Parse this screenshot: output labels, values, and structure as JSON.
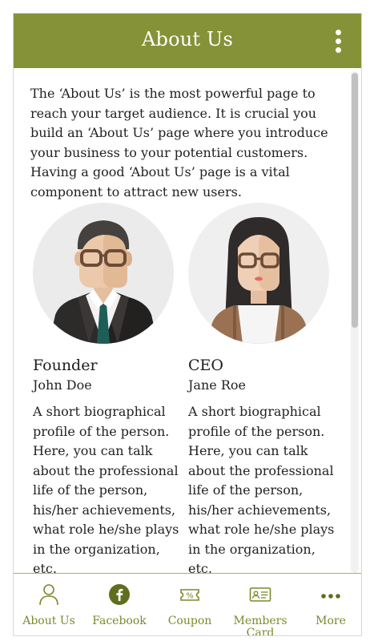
{
  "header": {
    "title": "About Us"
  },
  "intro": "The ‘About Us’ is the most powerful page to reach your target audience. It is crucial you build an ‘About Us’ page where you introduce your business to your potential customers. Having a good ‘About Us’ page is a vital component to attract new users.",
  "team": [
    {
      "role": "Founder",
      "name": "John Doe",
      "bio": "A short biographical profile of the person. Here, you can talk about the professional life of the person, his/her achievements, what role he/she plays in the organization, etc."
    },
    {
      "role": "CEO",
      "name": "Jane Roe",
      "bio": "A short biographical profile of the person. Here, you can talk about the professional life of the person, his/her achievements, what role he/she plays in the organization, etc."
    }
  ],
  "bottom_nav": {
    "items": [
      {
        "label": "About Us",
        "icon": "person-icon"
      },
      {
        "label": "Facebook",
        "icon": "facebook-icon"
      },
      {
        "label": "Coupon",
        "icon": "coupon-icon"
      },
      {
        "label": "Members Card",
        "icon": "members-card-icon"
      },
      {
        "label": "More",
        "icon": "more-dots-icon"
      }
    ]
  },
  "colors": {
    "header_bg": "#869237",
    "accent": "#7a8a2b",
    "facebook_bg": "#5f6e1f"
  }
}
